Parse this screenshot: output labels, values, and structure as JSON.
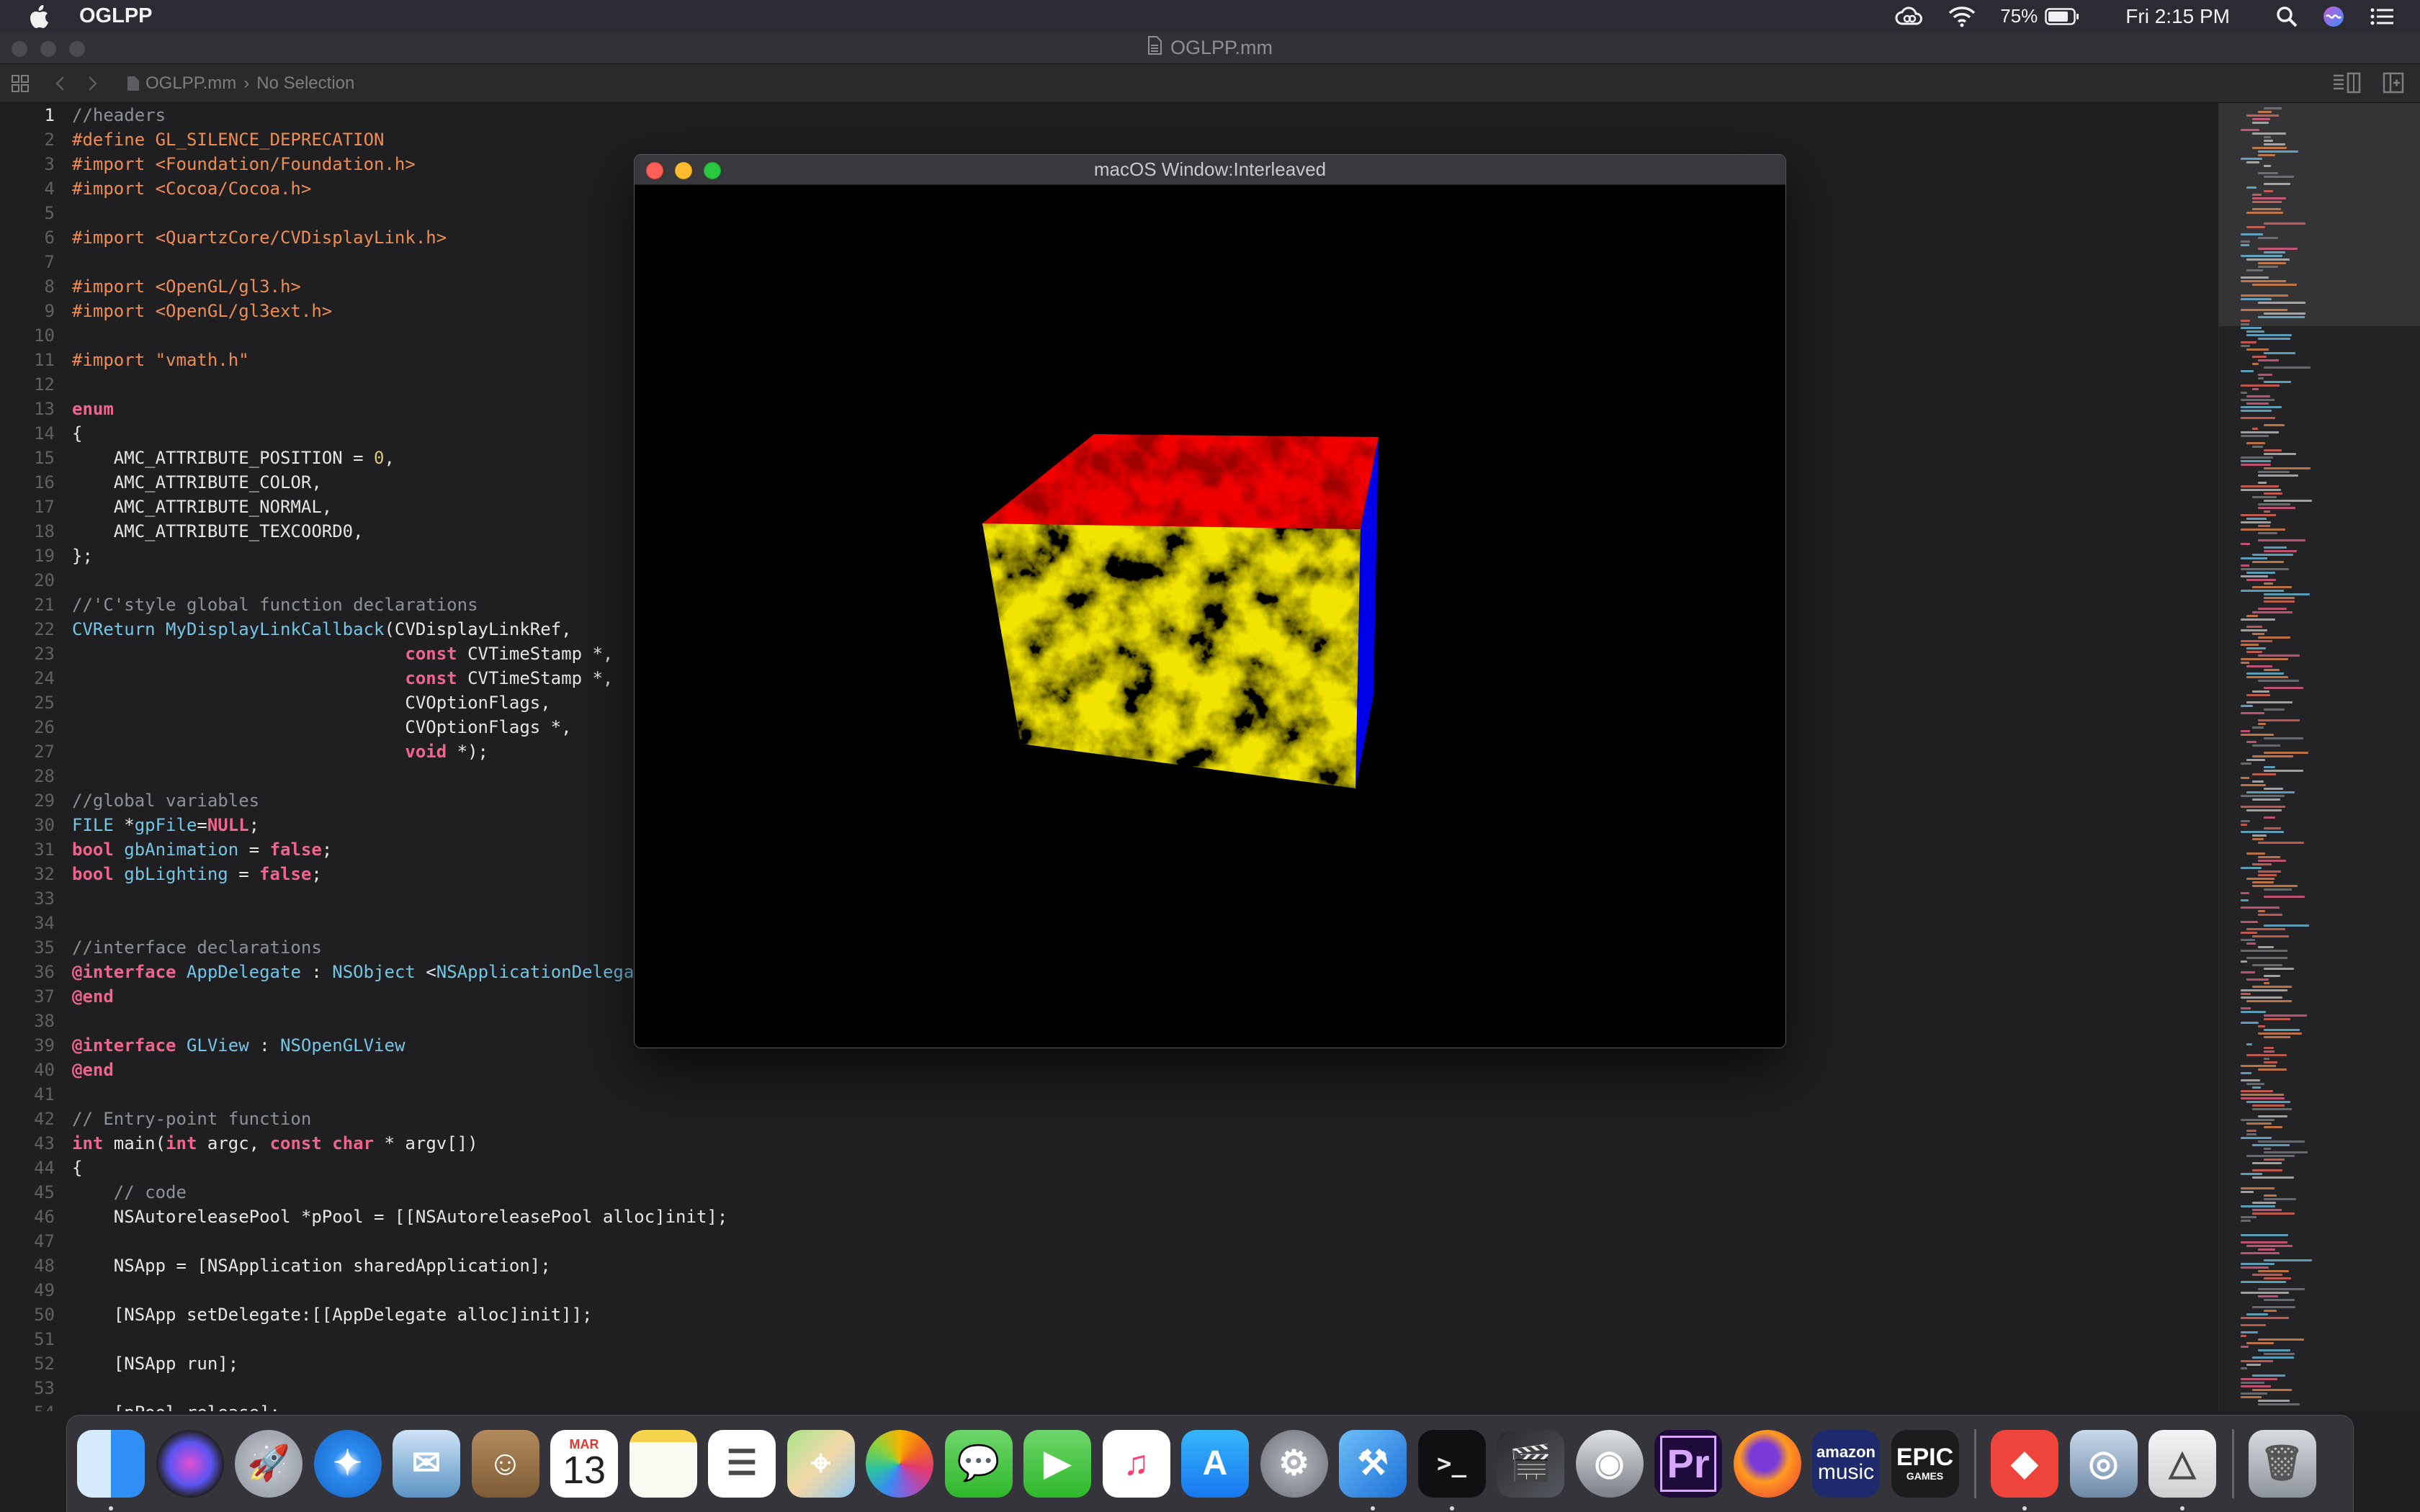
{
  "menubar": {
    "app_name": "OGLPP",
    "battery": "75%",
    "clock": "Fri 2:15 PM",
    "icons": [
      "apple-icon",
      "creative-cloud-icon",
      "wifi-icon",
      "battery-icon",
      "spotlight-icon",
      "siri-icon",
      "control-center-icon"
    ]
  },
  "xcode": {
    "title": "OGLPP.mm",
    "jumpbar_file": "OGLPP.mm",
    "jumpbar_selection": "No Selection"
  },
  "code": {
    "lines": [
      [
        [
          "//headers",
          "comment"
        ]
      ],
      [
        [
          "#define GL_SILENCE_DEPRECATION",
          "pp"
        ]
      ],
      [
        [
          "#import <Foundation/Foundation.h>",
          "pp"
        ]
      ],
      [
        [
          "#import <Cocoa/Cocoa.h>",
          "pp"
        ]
      ],
      [],
      [
        [
          "#import <QuartzCore/CVDisplayLink.h>",
          "pp"
        ]
      ],
      [],
      [
        [
          "#import <OpenGL/gl3.h>",
          "pp"
        ]
      ],
      [
        [
          "#import <OpenGL/gl3ext.h>",
          "pp"
        ]
      ],
      [],
      [
        [
          "#import \"vmath.h\"",
          "pp"
        ]
      ],
      [],
      [
        [
          "enum",
          "kw"
        ]
      ],
      [
        [
          "{",
          "plain"
        ]
      ],
      [
        [
          "    AMC_ATTRIBUTE_POSITION = ",
          "plain"
        ],
        [
          "0",
          "num"
        ],
        [
          ",",
          "plain"
        ]
      ],
      [
        [
          "    AMC_ATTRIBUTE_COLOR,",
          "plain"
        ]
      ],
      [
        [
          "    AMC_ATTRIBUTE_NORMAL,",
          "plain"
        ]
      ],
      [
        [
          "    AMC_ATTRIBUTE_TEXCOORD0,",
          "plain"
        ]
      ],
      [
        [
          "};",
          "plain"
        ]
      ],
      [],
      [
        [
          "//'C'style global function declarations",
          "comment"
        ]
      ],
      [
        [
          "CVReturn",
          "type"
        ],
        [
          " ",
          "plain"
        ],
        [
          "MyDisplayLinkCallback",
          "type"
        ],
        [
          "(CVDisplayLinkRef,",
          "plain"
        ]
      ],
      [
        [
          "                                ",
          "plain"
        ],
        [
          "const",
          "kw"
        ],
        [
          " CVTimeStamp *,",
          "plain"
        ]
      ],
      [
        [
          "                                ",
          "plain"
        ],
        [
          "const",
          "kw"
        ],
        [
          " CVTimeStamp *,",
          "plain"
        ]
      ],
      [
        [
          "                                CVOptionFlags,",
          "plain"
        ]
      ],
      [
        [
          "                                CVOptionFlags *,",
          "plain"
        ]
      ],
      [
        [
          "                                ",
          "plain"
        ],
        [
          "void",
          "kw"
        ],
        [
          " *);",
          "plain"
        ]
      ],
      [],
      [
        [
          "//global variables",
          "comment"
        ]
      ],
      [
        [
          "FILE",
          "type"
        ],
        [
          " *",
          "plain"
        ],
        [
          "gpFile",
          "type"
        ],
        [
          "=",
          "plain"
        ],
        [
          "NULL",
          "kw"
        ],
        [
          ";",
          "plain"
        ]
      ],
      [
        [
          "bool",
          "kw"
        ],
        [
          " ",
          "plain"
        ],
        [
          "gbAnimation",
          "type"
        ],
        [
          " = ",
          "plain"
        ],
        [
          "false",
          "kw"
        ],
        [
          ";",
          "plain"
        ]
      ],
      [
        [
          "bool",
          "kw"
        ],
        [
          " ",
          "plain"
        ],
        [
          "gbLighting",
          "type"
        ],
        [
          " = ",
          "plain"
        ],
        [
          "false",
          "kw"
        ],
        [
          ";",
          "plain"
        ]
      ],
      [],
      [],
      [
        [
          "//interface declarations",
          "comment"
        ]
      ],
      [
        [
          "@interface",
          "kw"
        ],
        [
          " ",
          "plain"
        ],
        [
          "AppDelegate",
          "type"
        ],
        [
          " : ",
          "plain"
        ],
        [
          "NSObject",
          "type"
        ],
        [
          " <",
          "plain"
        ],
        [
          "NSApplicationDelegate, NSWindowDelegate>",
          "type"
        ]
      ],
      [
        [
          "@end",
          "kw"
        ]
      ],
      [],
      [
        [
          "@interface",
          "kw"
        ],
        [
          " ",
          "plain"
        ],
        [
          "GLView",
          "type"
        ],
        [
          " : ",
          "plain"
        ],
        [
          "NSOpenGLView",
          "type"
        ]
      ],
      [
        [
          "@end",
          "kw"
        ]
      ],
      [],
      [
        [
          "// Entry-point function",
          "comment"
        ]
      ],
      [
        [
          "int",
          "kw"
        ],
        [
          " main(",
          "plain"
        ],
        [
          "int",
          "kw"
        ],
        [
          " argc, ",
          "plain"
        ],
        [
          "const",
          "kw"
        ],
        [
          " ",
          "plain"
        ],
        [
          "char",
          "kw"
        ],
        [
          " * argv[])",
          "plain"
        ]
      ],
      [
        [
          "{",
          "plain"
        ]
      ],
      [
        [
          "    // code",
          "comment"
        ]
      ],
      [
        [
          "    NSAutoreleasePool *pPool = [[NSAutoreleasePool alloc]init];",
          "plain"
        ]
      ],
      [],
      [
        [
          "    NSApp = [NSApplication sharedApplication];",
          "plain"
        ]
      ],
      [],
      [
        [
          "    [NSApp setDelegate:[[AppDelegate alloc]init]];",
          "plain"
        ]
      ],
      [],
      [
        [
          "    [NSApp run];",
          "plain"
        ]
      ],
      [],
      [
        [
          "    [pPool release];",
          "plain"
        ]
      ]
    ]
  },
  "gl_window": {
    "title": "macOS Window:Interleaved",
    "cube_faces": {
      "front": "#f2e400",
      "top": "#f20000",
      "right": "#0000e8"
    }
  },
  "dock": {
    "items": [
      {
        "name": "finder",
        "running": true
      },
      {
        "name": "siri",
        "running": false
      },
      {
        "name": "launchpad",
        "running": false
      },
      {
        "name": "safari",
        "running": false
      },
      {
        "name": "mail",
        "running": false
      },
      {
        "name": "contacts",
        "running": false
      },
      {
        "name": "calendar",
        "month": "MAR",
        "day": "13",
        "running": false
      },
      {
        "name": "notes",
        "running": false
      },
      {
        "name": "reminders",
        "running": false
      },
      {
        "name": "maps",
        "running": false
      },
      {
        "name": "photos",
        "running": false
      },
      {
        "name": "messages",
        "running": false
      },
      {
        "name": "facetime",
        "running": false
      },
      {
        "name": "itunes",
        "running": false
      },
      {
        "name": "app-store",
        "running": false
      },
      {
        "name": "system-preferences",
        "running": false
      },
      {
        "name": "xcode",
        "running": true
      },
      {
        "name": "terminal",
        "running": true
      },
      {
        "name": "final-cut-pro",
        "running": false
      },
      {
        "name": "compressor",
        "running": false
      },
      {
        "name": "premiere-pro",
        "label": "Pr",
        "running": false
      },
      {
        "name": "firefox",
        "running": false
      },
      {
        "name": "amazon-music",
        "label_top": "amazon",
        "label_bottom": "music",
        "running": false
      },
      {
        "name": "epic-games",
        "label_top": "EPIC",
        "label_bottom": "GAMES",
        "running": false
      },
      {
        "name": "anydesk",
        "running": true
      },
      {
        "name": "preview",
        "running": false
      },
      {
        "name": "instruments",
        "running": true
      },
      {
        "name": "trash",
        "running": false
      }
    ]
  }
}
